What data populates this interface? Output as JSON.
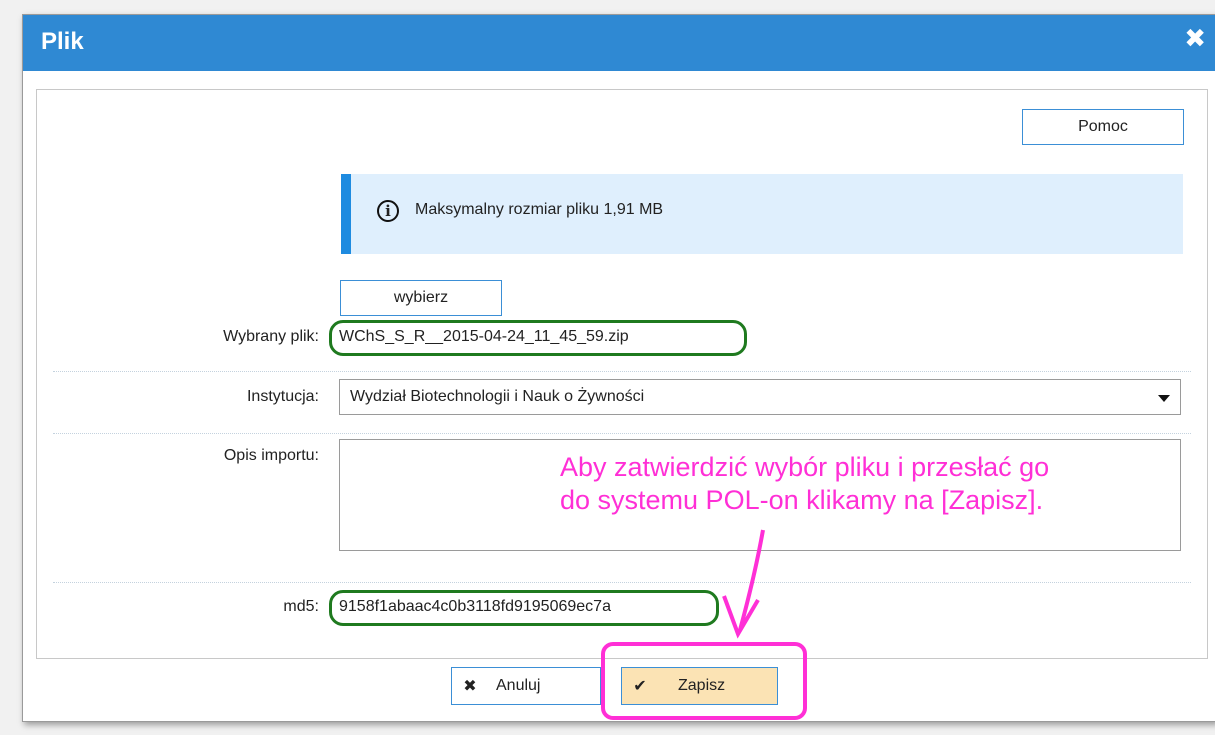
{
  "dialog": {
    "title": "Plik",
    "close_icon": "close-icon"
  },
  "toolbar": {
    "help_label": "Pomoc"
  },
  "info": {
    "icon": "info-icon",
    "text": "Maksymalny rozmiar pliku 1,91 MB"
  },
  "file": {
    "choose_label": "wybierz",
    "selected_label": "Wybrany plik:",
    "selected_value": "WChS_S_R__2015-04-24_11_45_59.zip"
  },
  "institution": {
    "label": "Instytucja:",
    "value": "Wydział Biotechnologii i Nauk o Żywności"
  },
  "description": {
    "label": "Opis importu:",
    "value": ""
  },
  "md5": {
    "label": "md5:",
    "value": "9158f1abaac4c0b3118fd9195069ec7a"
  },
  "footer": {
    "cancel_label": "Anuluj",
    "cancel_icon": "x-icon",
    "save_label": "Zapisz",
    "save_icon": "checkmark-icon"
  },
  "annotation": {
    "line1": "Aby zatwierdzić wybór pliku i przesłać go",
    "line2": "do systemu POL-on klikamy na [Zapisz]."
  },
  "colors": {
    "titlebar": "#2f89d3",
    "info_bg": "#dfeffd",
    "info_accent": "#1e8be0",
    "highlight_green": "#1f7a1f",
    "annotation_magenta": "#ff2fd6",
    "save_bg": "#fbe3b4"
  }
}
